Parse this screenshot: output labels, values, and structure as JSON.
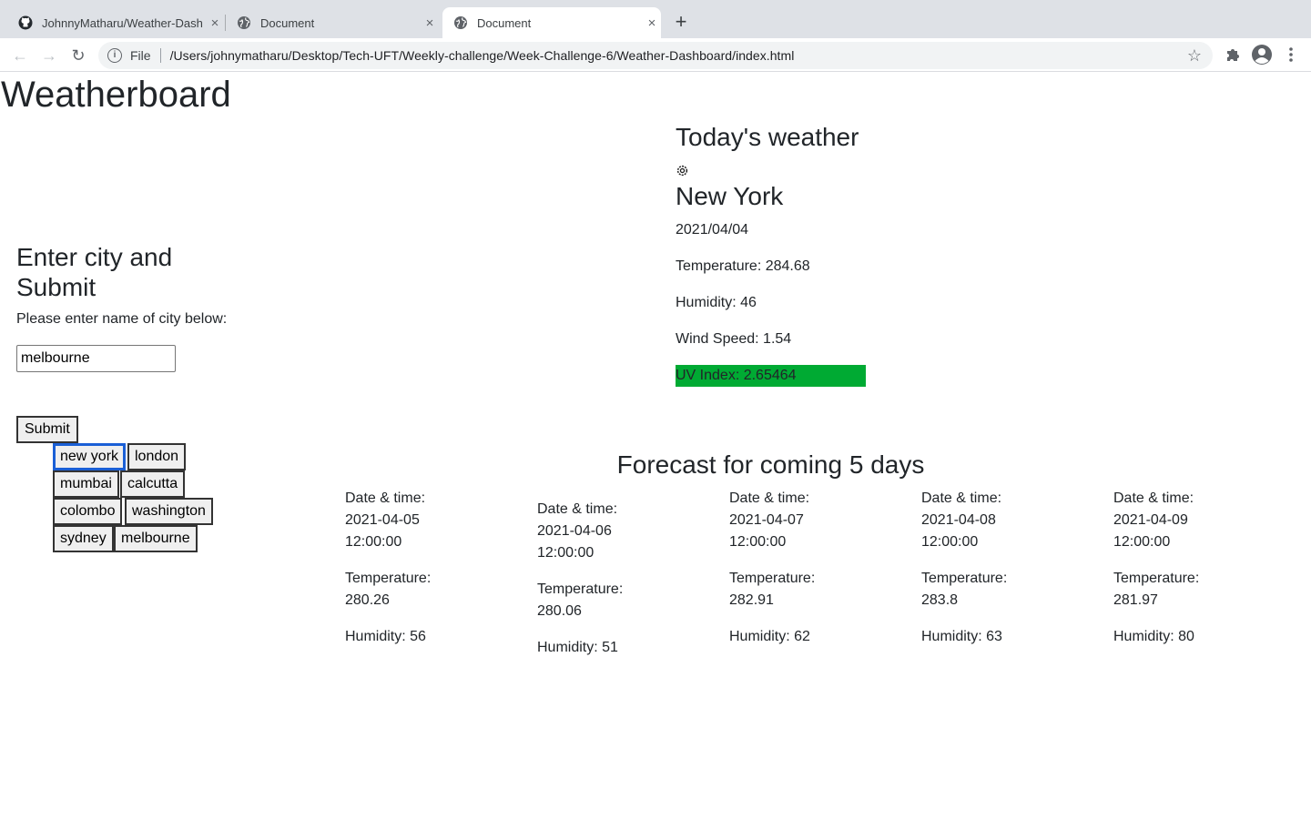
{
  "browser": {
    "tabs": [
      {
        "title": "JohnnyMatharu/Weather-Dash",
        "close": "×"
      },
      {
        "title": "Document",
        "close": "×"
      },
      {
        "title": "Document",
        "close": "×"
      }
    ],
    "new_tab": "+",
    "omnibox": {
      "scheme": "File",
      "url": "/Users/johnymatharu/Desktop/Tech-UFT/Weekly-challenge/Week-Challenge-6/Weather-Dashboard/index.html"
    }
  },
  "page": {
    "brand": "Weatherboard",
    "search": {
      "heading": "Enter city and Submit",
      "prompt": "Please enter name of city below:",
      "input_value": "melbourne",
      "submit_label": "Submit"
    },
    "history": [
      "new york",
      "london",
      "mumbai",
      "calcutta",
      "colombo",
      "washington",
      "sydney",
      "melbourne"
    ],
    "today": {
      "heading": "Today's weather",
      "city": "New York",
      "date": "2021/04/04",
      "temperature": "Temperature: 284.68",
      "humidity": "Humidity: 46",
      "wind": "Wind Speed: 1.54",
      "uv": "UV Index: 2.65464",
      "uv_color": "#00aa33"
    },
    "forecast": {
      "heading": "Forecast for coming 5 days",
      "days": [
        {
          "date": "Date & time: 2021-04-05 12:00:00",
          "temp": "Temperature: 280.26",
          "humidity": "Humidity: 56"
        },
        {
          "date": "Date & time: 2021-04-06 12:00:00",
          "temp": "Temperature: 280.06",
          "humidity": "Humidity: 51"
        },
        {
          "date": "Date & time: 2021-04-07 12:00:00",
          "temp": "Temperature: 282.91",
          "humidity": "Humidity: 62"
        },
        {
          "date": "Date & time: 2021-04-08 12:00:00",
          "temp": "Temperature: 283.8",
          "humidity": "Humidity: 63"
        },
        {
          "date": "Date & time: 2021-04-09 12:00:00",
          "temp": "Temperature: 281.97",
          "humidity": "Humidity: 80"
        }
      ]
    }
  }
}
